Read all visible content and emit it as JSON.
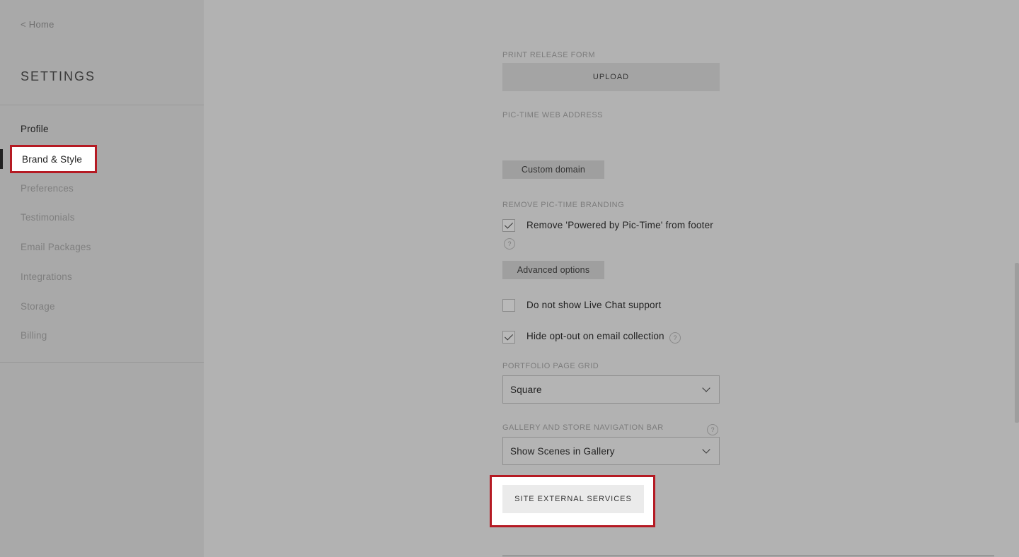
{
  "sidebar": {
    "home_link": "< Home",
    "title": "SETTINGS",
    "items": [
      {
        "label": "Profile"
      },
      {
        "label": "Brand & Style"
      },
      {
        "label": "Preferences"
      },
      {
        "label": "Testimonials"
      },
      {
        "label": "Email Packages"
      },
      {
        "label": "Integrations"
      },
      {
        "label": "Storage"
      },
      {
        "label": "Billing"
      }
    ]
  },
  "form": {
    "print_release": {
      "label": "PRINT RELEASE FORM",
      "button": "UPLOAD"
    },
    "web_address": {
      "label": "PIC-TIME WEB ADDRESS",
      "button": "Custom domain"
    },
    "branding": {
      "label": "REMOVE PIC-TIME BRANDING",
      "checkbox_label": "Remove 'Powered by Pic-Time' from footer",
      "checked": true,
      "advanced_button": "Advanced options"
    },
    "live_chat": {
      "checkbox_label": "Do not show Live Chat support",
      "checked": false
    },
    "opt_out": {
      "checkbox_label": "Hide opt-out on email collection",
      "checked": true
    },
    "portfolio_grid": {
      "label": "PORTFOLIO PAGE GRID",
      "value": "Square"
    },
    "nav_bar": {
      "label": "GALLERY AND STORE NAVIGATION BAR",
      "value": "Show Scenes in Gallery"
    },
    "external_services": {
      "button": "SITE EXTERNAL SERVICES"
    }
  },
  "icons": {
    "help": "?"
  },
  "colors": {
    "highlight": "#b51a23"
  }
}
